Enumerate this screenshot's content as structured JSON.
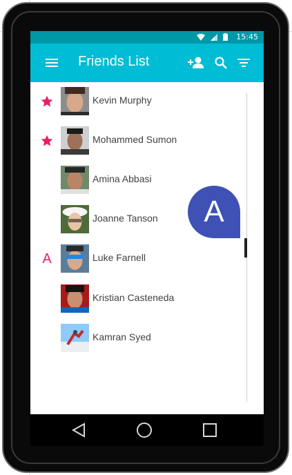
{
  "status_bar": {
    "time": "15:45",
    "icons": [
      "wifi-icon",
      "signal-icon",
      "battery-icon"
    ]
  },
  "app_bar": {
    "title": "Friends List",
    "actions": [
      "add-person-icon",
      "search-icon",
      "filter-icon"
    ]
  },
  "friends": [
    {
      "name": "Kevin Murphy",
      "marker": "star",
      "avatar_color": "#6d4c41"
    },
    {
      "name": "Mohammed Sumon",
      "marker": "star",
      "avatar_color": "#4e342e"
    },
    {
      "name": "Amina Abbasi",
      "marker": "",
      "avatar_color": "#795548"
    },
    {
      "name": "Joanne Tanson",
      "marker": "",
      "avatar_color": "#5d4037"
    },
    {
      "name": "Luke Farnell",
      "marker": "A",
      "avatar_color": "#2e4a62"
    },
    {
      "name": "Kristian Casteneda",
      "marker": "",
      "avatar_color": "#263238"
    },
    {
      "name": "Kamran Syed",
      "marker": "",
      "avatar_color": "#81d4fa"
    }
  ],
  "scroll_bubble_letter": "A",
  "colors": {
    "status_bar": "#0097a7",
    "app_bar": "#00bcd4",
    "accent": "#e91e63",
    "bubble": "#3f51b5"
  }
}
